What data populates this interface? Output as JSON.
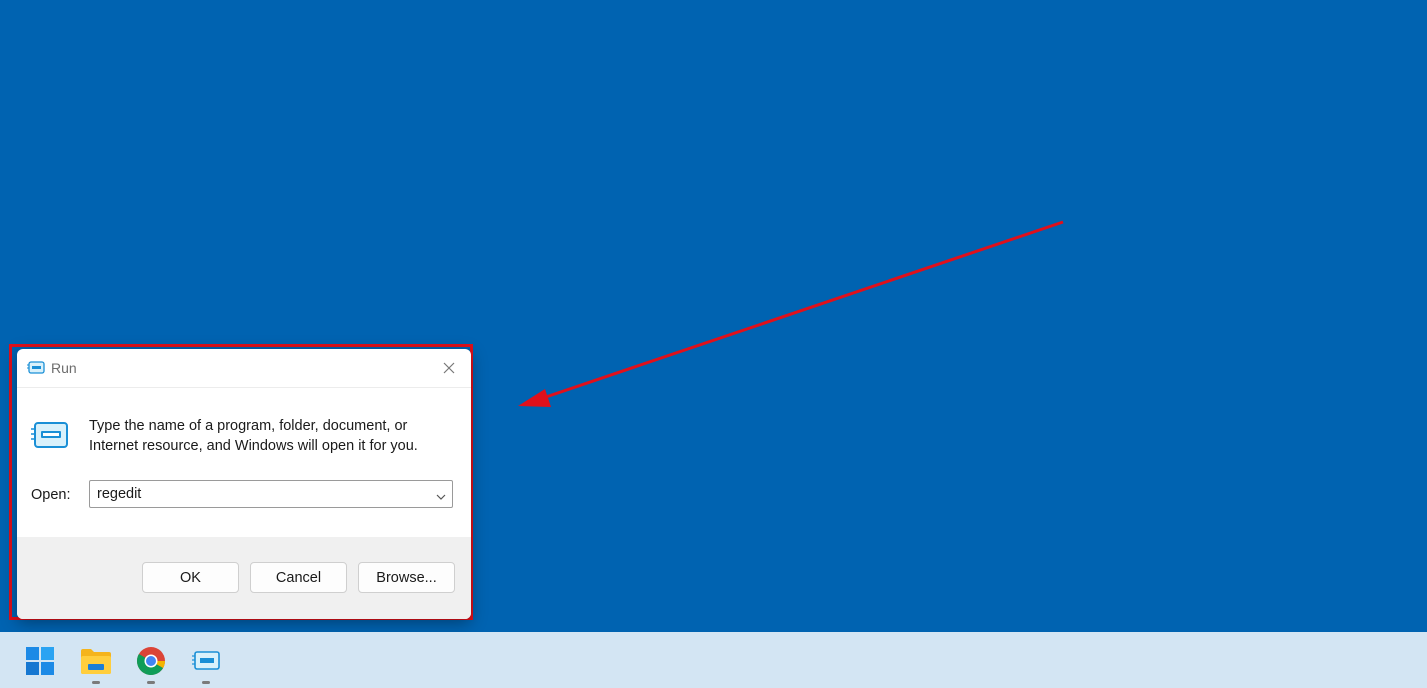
{
  "dialog": {
    "title": "Run",
    "description_line1": "Type the name of a program, folder, document, or",
    "description_line2": "Internet resource, and Windows will open it for you.",
    "open_label": "Open:",
    "open_value": "regedit",
    "ok_label": "OK",
    "cancel_label": "Cancel",
    "browse_label": "Browse..."
  },
  "icons": {
    "title": "run-icon",
    "dialog": "run-icon",
    "close": "close-icon",
    "dropdown": "chevron-down-icon"
  },
  "taskbar": {
    "items": [
      {
        "name": "windows-start",
        "icon": "windows-logo-icon",
        "running": false
      },
      {
        "name": "file-explorer",
        "icon": "folder-icon",
        "running": true
      },
      {
        "name": "chrome",
        "icon": "chrome-icon",
        "running": true
      },
      {
        "name": "run",
        "icon": "run-icon",
        "running": true
      }
    ]
  },
  "colors": {
    "desktop": "#0063b1",
    "taskbar": "#d3e5f3",
    "highlight": "#e0101b",
    "arrow": "#e0101b"
  }
}
